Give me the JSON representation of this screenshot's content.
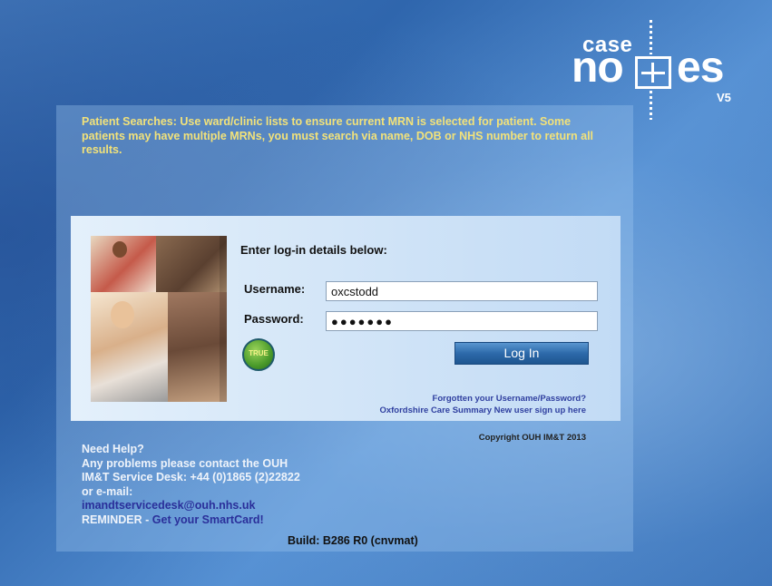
{
  "logo": {
    "case": "case",
    "no": "no",
    "es": "es",
    "version": "V5"
  },
  "notice": "Patient Searches: Use ward/clinic lists to ensure current MRN is selected for patient. Some patients may have multiple MRNs, you must search via name, DOB or NHS number to return all results.",
  "login": {
    "title": "Enter log-in details below:",
    "username_label": "Username:",
    "username_value": "oxcstodd",
    "password_label": "Password:",
    "password_value": "●●●●●●●",
    "badge_text": "TRUE",
    "button_label": "Log In",
    "forgot_link": "Forgotten your Username/Password?",
    "signup_link": "Oxfordshire Care Summary New user sign up here"
  },
  "copyright": "Copyright OUH IM&T 2013",
  "help": {
    "heading": "Need Help?",
    "line1": "Any problems please contact the OUH",
    "line2": "IM&T Service Desk: +44 (0)1865 (2)22822",
    "line3": "or e-mail:",
    "email": "imandtservicedesk@ouh.nhs.uk",
    "reminder_prefix": "REMINDER - ",
    "reminder_link": "Get your SmartCard!"
  },
  "build": "Build: B286 R0 (cnvmat)",
  "colors": {
    "notice_text": "#f2e27a",
    "button_blue": "#2d6aaa",
    "link_blue": "#3040a0"
  }
}
